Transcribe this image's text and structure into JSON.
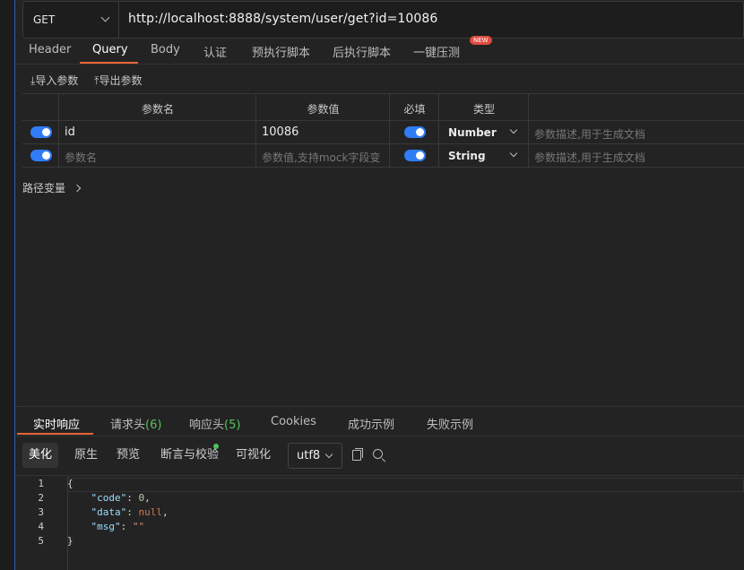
{
  "request": {
    "method": "GET",
    "url": "http://localhost:8888/system/user/get?id=10086"
  },
  "tabs": [
    "Header",
    "Query",
    "Body",
    "认证",
    "预执行脚本",
    "后执行脚本",
    "一键压测"
  ],
  "active_tab": "Query",
  "new_badge": "NEW",
  "tools": {
    "import": "导入参数",
    "export": "导出参数"
  },
  "params": {
    "headers": [
      "参数名",
      "参数值",
      "必填",
      "类型"
    ],
    "rows": [
      {
        "enabled": true,
        "name": "id",
        "value": "10086",
        "required": true,
        "type": "Number",
        "desc_placeholder": "参数描述,用于生成文档"
      },
      {
        "enabled": true,
        "name_placeholder": "参数名",
        "value_placeholder": "参数值,支持mock字段变",
        "required": true,
        "type": "String",
        "desc_placeholder": "参数描述,用于生成文档"
      }
    ]
  },
  "path_variables": "路径变量",
  "response": {
    "tabs": [
      {
        "label": "实时响应",
        "count": ""
      },
      {
        "label": "请求头",
        "count": "(6)"
      },
      {
        "label": "响应头",
        "count": "(5)"
      },
      {
        "label": "Cookies",
        "count": ""
      },
      {
        "label": "成功示例",
        "count": ""
      },
      {
        "label": "失败示例",
        "count": ""
      }
    ],
    "view_modes": [
      "美化",
      "原生",
      "预览",
      "断言与校验",
      "可视化"
    ],
    "active_view": "美化",
    "encoding": "utf8",
    "code": {
      "line_numbers": [
        "1",
        "2",
        "3",
        "4",
        "5"
      ],
      "open_brace": "{",
      "close_brace": "}",
      "code_key": "\"code\"",
      "code_value": "0",
      "data_key": "\"data\"",
      "data_value": "null",
      "msg_key": "\"msg\"",
      "msg_value": "\"\""
    }
  },
  "colors": {
    "accent": "#e8643a",
    "toggle": "#2f7cf6",
    "count": "#56c25e",
    "badge": "#e04b3f"
  }
}
